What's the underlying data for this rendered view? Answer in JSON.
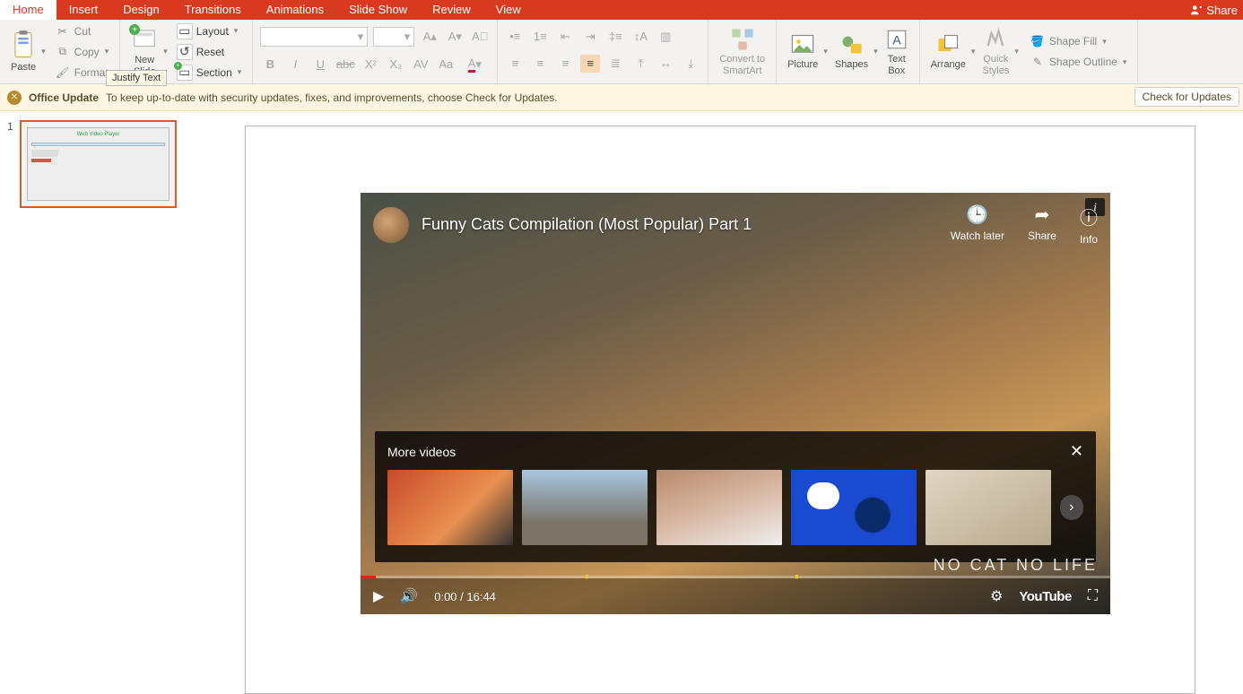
{
  "tabs": [
    "Home",
    "Insert",
    "Design",
    "Transitions",
    "Animations",
    "Slide Show",
    "Review",
    "View"
  ],
  "tabbar": {
    "share": "Share"
  },
  "ribbon": {
    "paste": "Paste",
    "cut": "Cut",
    "copy": "Copy",
    "format": "Format",
    "newslide": "New\nSlide",
    "layout": "Layout",
    "reset": "Reset",
    "section": "Section",
    "convert": "Convert to\nSmartArt",
    "picture": "Picture",
    "shapes": "Shapes",
    "textbox": "Text\nBox",
    "arrange": "Arrange",
    "quickstyles": "Quick\nStyles",
    "shapefill": "Shape Fill",
    "shapeoutline": "Shape Outline"
  },
  "tooltip": "Justify Text",
  "update": {
    "title": "Office Update",
    "msg": "To keep up-to-date with security updates, fixes, and improvements, choose Check for Updates.",
    "button": "Check for Updates"
  },
  "thumb": {
    "num": "1",
    "title": "Web Video Player"
  },
  "video": {
    "title": "Funny Cats Compilation (Most Popular) Part 1",
    "watch": "Watch later",
    "share": "Share",
    "info": "Info",
    "more": "More videos",
    "time": "0:00 / 16:44",
    "watermark": "NO CAT NO LIFE",
    "youtube": "YouTube"
  }
}
